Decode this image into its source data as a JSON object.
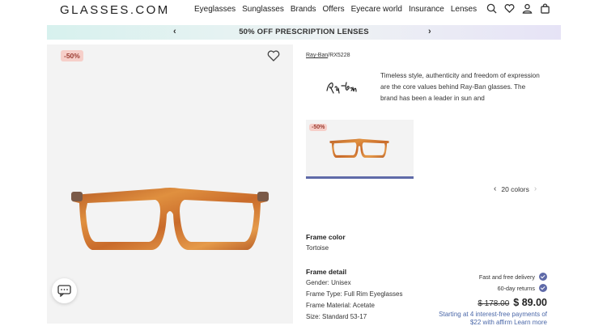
{
  "header": {
    "logo": "GLASSES.COM",
    "nav": [
      "Eyeglasses",
      "Sunglasses",
      "Brands",
      "Offers",
      "Eyecare world",
      "Insurance",
      "Lenses"
    ]
  },
  "promo": {
    "text": "50% OFF PRESCRIPTION LENSES",
    "prev": "‹",
    "next": "›"
  },
  "gallery": {
    "badge": "-50%"
  },
  "product": {
    "breadcrumb_brand": "Ray-Ban",
    "breadcrumb_sep": "/",
    "breadcrumb_model": "RX5228",
    "description": "Timeless style, authenticity and freedom of expression are the core values behind Ray-Ban glasses. The brand has been a leader in sun and",
    "thumb_badge": "-50%",
    "colors_label": "20 colors",
    "frame_color_title": "Frame color",
    "frame_color_value": "Tortoise",
    "frame_detail_title": "Frame detail",
    "details": [
      "Gender: Unisex",
      "Frame Type: Full Rim Eyeglasses",
      "Frame Material: Acetate",
      "Size: Standard 53-17"
    ]
  },
  "purchase": {
    "perks": [
      "Fast and free delivery",
      "60-day returns"
    ],
    "old_price": "$ 178.00",
    "new_price": "$ 89.00",
    "affirm_line1": "Starting at 4 interest-free payments of",
    "affirm_line2": "$22 with affirm  Learn more"
  },
  "colors": {
    "accent": "#5f6aa8",
    "badge_bg": "#f6cfc9",
    "badge_text": "#9c3d33",
    "frame": "#c8702f"
  }
}
